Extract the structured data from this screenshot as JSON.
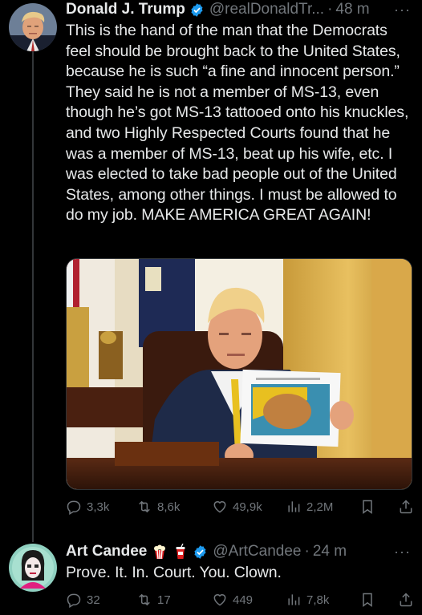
{
  "tweets": [
    {
      "display_name": "Donald J. Trump",
      "handle": "@realDonaldTr...",
      "time": "48 m",
      "text": "This is the hand of the man that the Democrats feel should be brought back to the United States, because he is such “a fine and innocent person.” They said he is not a member of MS-13, even though he’s got MS-13 tattooed onto his knuckles, and two Highly Respected Courts found that he was a member of MS-13, beat up his wife, etc. I was elected to take bad people out of the United States, among other things. I must be allowed to do my job. MAKE AMERICA GREAT AGAIN!",
      "media_alt": "Photo of man seated at desk holding a printed image of a tattooed fist",
      "stats": {
        "replies": "3,3k",
        "reposts": "8,6k",
        "likes": "49,9k",
        "views": "2,2M"
      }
    },
    {
      "display_name": "Art Candee",
      "handle": "@ArtCandee",
      "time": "24 m",
      "text": "Prove. It. In. Court. You. Clown.",
      "stats": {
        "replies": "32",
        "reposts": "17",
        "likes": "449",
        "views": "7,8k"
      }
    }
  ],
  "more_label": "···",
  "separator": "·",
  "icons": {
    "verified": "verified-badge-icon",
    "reply": "reply-icon",
    "repost": "repost-icon",
    "like": "heart-icon",
    "views": "views-icon",
    "bookmark": "bookmark-icon",
    "share": "share-icon",
    "popcorn": "popcorn-emoji-icon",
    "cup": "cup-emoji-icon"
  },
  "colors": {
    "background": "#000000",
    "text": "#e7e9ea",
    "muted": "#71767b",
    "verified": "#1d9bf0",
    "thread_line": "#333639"
  }
}
